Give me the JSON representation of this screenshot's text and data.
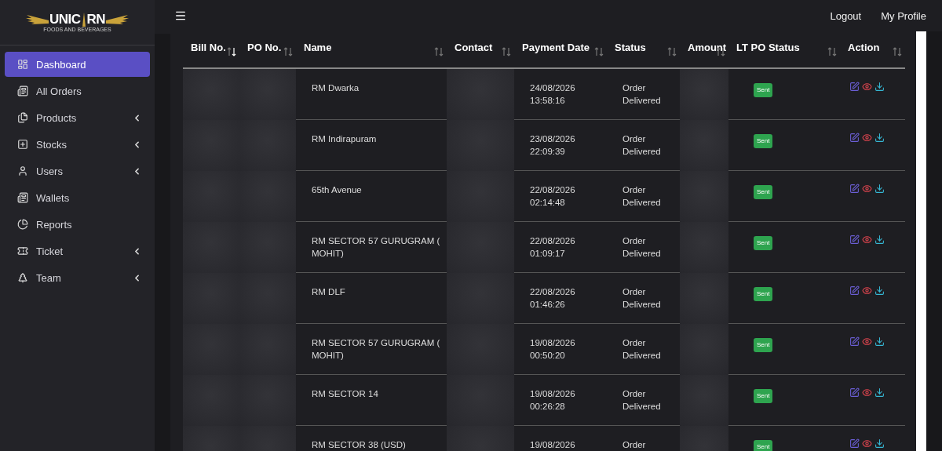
{
  "logo": {
    "left": "UNIC",
    "right": "RN",
    "tagline": "FOODS AND BEVERAGES"
  },
  "sidebar": {
    "items": [
      {
        "label": "Dashboard",
        "selected": true,
        "expandable": false
      },
      {
        "label": "All Orders",
        "selected": false,
        "expandable": false
      },
      {
        "label": "Products",
        "selected": false,
        "expandable": true
      },
      {
        "label": "Stocks",
        "selected": false,
        "expandable": true
      },
      {
        "label": "Users",
        "selected": false,
        "expandable": true
      },
      {
        "label": "Wallets",
        "selected": false,
        "expandable": false
      },
      {
        "label": "Reports",
        "selected": false,
        "expandable": false
      },
      {
        "label": "Ticket",
        "selected": false,
        "expandable": true
      },
      {
        "label": "Team",
        "selected": false,
        "expandable": true
      }
    ]
  },
  "topbar": {
    "links": [
      "Logout",
      "My Profile"
    ]
  },
  "table": {
    "columns": [
      {
        "label": "Bill No.",
        "sorted": true,
        "blurred": true
      },
      {
        "label": "PO No.",
        "sorted": false,
        "blurred": true
      },
      {
        "label": "Name",
        "sorted": false,
        "blurred": false
      },
      {
        "label": "Contact",
        "sorted": false,
        "blurred": true
      },
      {
        "label": "Payment Date",
        "sorted": false,
        "blurred": false
      },
      {
        "label": "Status",
        "sorted": false,
        "blurred": false
      },
      {
        "label": "Amount",
        "sorted": false,
        "blurred": true
      },
      {
        "label": "LT PO Status",
        "sorted": false,
        "blurred": false
      },
      {
        "label": "Action",
        "sorted": false,
        "blurred": false
      }
    ],
    "rows": [
      {
        "name": "RM Dwarka",
        "date": "24/08/2026",
        "time": "13:58:16",
        "status": [
          "Order",
          "Delivered"
        ],
        "lt_po_status": "Sent"
      },
      {
        "name": "RM Indirapuram",
        "date": "23/08/2026",
        "time": "22:09:39",
        "status": [
          "Order",
          "Delivered"
        ],
        "lt_po_status": "Sent"
      },
      {
        "name": "65th Avenue",
        "date": "22/08/2026",
        "time": "02:14:48",
        "status": [
          "Order",
          "Delivered"
        ],
        "lt_po_status": "Sent"
      },
      {
        "name": "RM SECTOR 57 GURUGRAM ( MOHIT)",
        "date": "22/08/2026",
        "time": "01:09:17",
        "status": [
          "Order",
          "Delivered"
        ],
        "lt_po_status": "Sent"
      },
      {
        "name": "RM DLF",
        "date": "22/08/2026",
        "time": "01:46:26",
        "status": [
          "Order",
          "Delivered"
        ],
        "lt_po_status": "Sent"
      },
      {
        "name": "RM SECTOR 57 GURUGRAM ( MOHIT)",
        "date": "19/08/2026",
        "time": "00:50:20",
        "status": [
          "Order",
          "Delivered"
        ],
        "lt_po_status": "Sent"
      },
      {
        "name": "RM SECTOR 14",
        "date": "19/08/2026",
        "time": "00:26:28",
        "status": [
          "Order",
          "Delivered"
        ],
        "lt_po_status": "Sent"
      },
      {
        "name": "RM SECTOR 38 (USD)",
        "date": "19/08/2026",
        "status": [
          "Order"
        ],
        "lt_po_status": "Sent"
      }
    ]
  }
}
